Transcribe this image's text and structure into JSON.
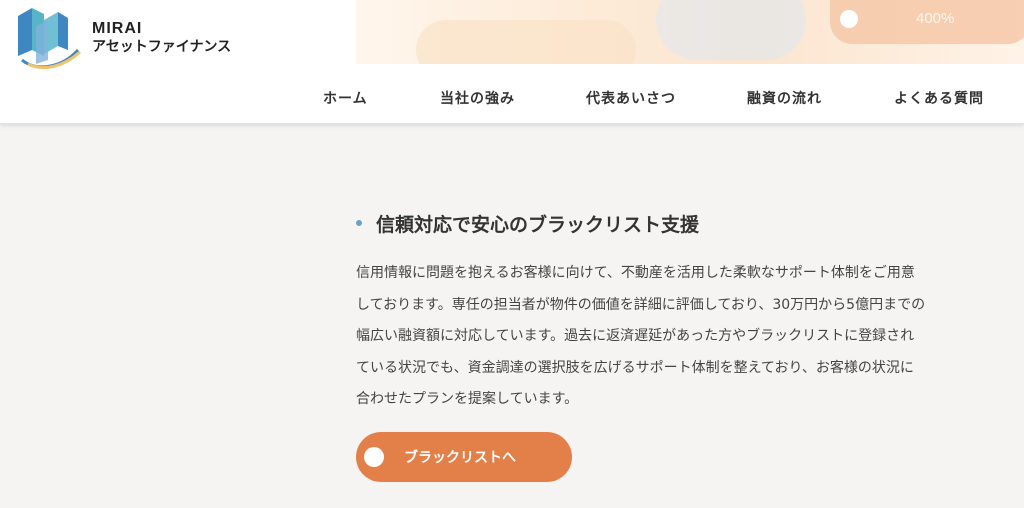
{
  "brand": {
    "name_en": "MIRAI",
    "name_jp": "アセットファイナンス",
    "colors": {
      "logo_blue": "#3f87c2",
      "logo_teal": "#58b5c8",
      "logo_gold": "#f2c26b"
    }
  },
  "hero": {
    "pill_text": "400%"
  },
  "nav": {
    "items": [
      {
        "label": "ホーム"
      },
      {
        "label": "当社の強み"
      },
      {
        "label": "代表あいさつ"
      },
      {
        "label": "融資の流れ"
      },
      {
        "label": "よくある質問"
      }
    ]
  },
  "main": {
    "heading": "信頼対応で安心のブラックリスト支援",
    "paragraph_lines": [
      "信用情報に問題を抱えるお客様に向けて、不動産を活用した柔軟なサポート体制をご用意",
      "しております。専任の担当者が物件の価値を詳細に評価しており、30万円から5億円までの",
      "幅広い融資額に対応しています。過去に返済遅延があった方やブラックリストに登録され",
      "ている状況でも、資金調達の選択肢を広げるサポート体制を整えており、お客様の状況に",
      "合わせたプランを提案しています。"
    ],
    "cta_label": "ブラックリストへ"
  },
  "colors": {
    "background": "#f5f4f2",
    "cta": "#e3804a",
    "bullet": "#6aa0cc"
  }
}
